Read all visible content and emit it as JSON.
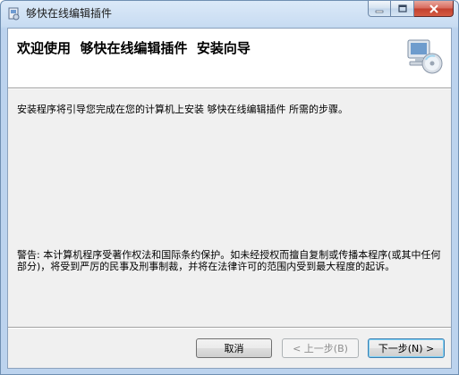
{
  "window": {
    "title": "够快在线编辑插件",
    "minimize_glyph": "–",
    "maximize_glyph": "□",
    "close_glyph": "✕"
  },
  "header": {
    "heading": "欢迎使用  够快在线编辑插件  安装向导",
    "graphic_icon": "computer-with-cd-icon"
  },
  "body": {
    "intro": "安装程序将引导您完成在您的计算机上安装 够快在线编辑插件 所需的步骤。",
    "warning": "警告: 本计算机程序受著作权法和国际条约保护。如未经授权而擅自复制或传播本程序(或其中任何部分)，将受到严厉的民事及刑事制裁，并将在法律许可的范围内受到最大程度的起诉。"
  },
  "buttons": {
    "cancel": "取消",
    "back": "< 上一步(B)",
    "next": "下一步(N) >"
  }
}
